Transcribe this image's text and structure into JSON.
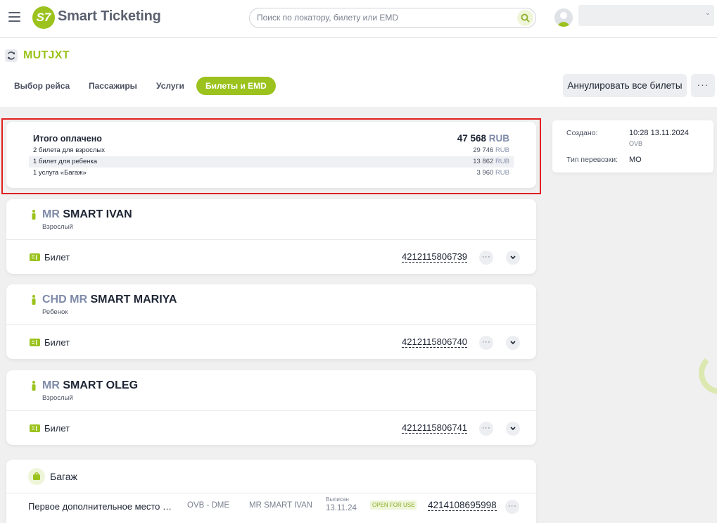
{
  "header": {
    "logo_badge": "S7",
    "logo_text": "Smart Ticketing",
    "search_placeholder": "Поиск по локатору, билету или EMD"
  },
  "booking": {
    "pnr": "MUTJXT",
    "tabs": [
      {
        "label": "Выбор рейса",
        "active": false
      },
      {
        "label": "Пассажиры",
        "active": false
      },
      {
        "label": "Услуги",
        "active": false
      },
      {
        "label": "Билеты и EMD",
        "active": true
      }
    ],
    "cancel_all_label": "Аннулировать все билеты",
    "more_label": "···"
  },
  "totals": {
    "title": "Итого оплачено",
    "amount": "47 568",
    "currency": "RUB",
    "rows": [
      {
        "label": "2 билета для взрослых",
        "amount": "29 746",
        "currency": "RUB"
      },
      {
        "label": "1 билет для ребенка",
        "amount": "13 862",
        "currency": "RUB"
      },
      {
        "label": "1 услуга «Багаж»",
        "amount": "3 960",
        "currency": "RUB"
      }
    ]
  },
  "passengers": [
    {
      "title": "MR",
      "name": "SMART IVAN",
      "type": "Взрослый",
      "ticket_label": "Билет",
      "ticket_number": "4212115806739"
    },
    {
      "title": "CHD MR",
      "name": "SMART MARIYA",
      "type": "Ребенок",
      "ticket_label": "Билет",
      "ticket_number": "4212115806740"
    },
    {
      "title": "MR",
      "name": "SMART OLEG",
      "type": "Взрослый",
      "ticket_label": "Билет",
      "ticket_number": "4212115806741"
    }
  ],
  "baggage": {
    "title": "Багаж",
    "service": "Первое дополнительное место багажа",
    "route": "OVB - DME",
    "passenger": "MR SMART IVAN",
    "issued_label": "Выписан",
    "issued_date": "13.11.24",
    "status": "OPEN FOR USE",
    "emd_number": "4214108695998"
  },
  "info": {
    "created_label": "Создано:",
    "created_value": "10:28 13.11.2024",
    "created_office": "OVB",
    "transport_label": "Тип перевозки:",
    "transport_value": "МО"
  },
  "colors": {
    "brand": "#9bc21d",
    "highlight_frame": "#e02020"
  }
}
